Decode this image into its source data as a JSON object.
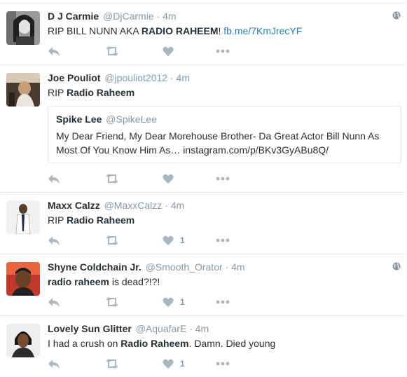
{
  "tweets": [
    {
      "name": "D J Carmie",
      "handle": "@DjCarmie",
      "time": "4m",
      "text_parts": [
        "RIP BILL NUNN AKA ",
        "RADIO RAHEEM",
        "! ",
        "fb.me/7KmJrecYF"
      ],
      "like_count": "",
      "has_globe": true
    },
    {
      "name": "Joe Pouliot",
      "handle": "@jpouliot2012",
      "time": "4m",
      "text_parts": [
        "RIP ",
        "Radio Raheem"
      ],
      "like_count": "",
      "quote": {
        "name": "Spike Lee",
        "handle": "@SpikeLee",
        "text": "My Dear Friend, My Dear Morehouse Brother- Da Great Actor Bill Nunn As Most Of You Know Him As… instagram.com/p/BKv3GyABu8Q/"
      }
    },
    {
      "name": "Maxx Calzz",
      "handle": "@MaxxCalzz",
      "time": "4m",
      "text_parts": [
        "RIP ",
        "Radio Raheem"
      ],
      "like_count": "1"
    },
    {
      "name": "Shyne Coldchain Jr.",
      "handle": "@Smooth_Orator",
      "time": "4m",
      "text_parts": [
        "radio raheem",
        " is dead?!?!"
      ],
      "like_count": "1",
      "has_globe": true
    },
    {
      "name": "Lovely Sun Glitter",
      "handle": "@AquafarE",
      "time": "4m",
      "text_parts": [
        "I had a crush on ",
        "Radio Raheem",
        ". Damn. Died young"
      ],
      "like_count": "1"
    }
  ],
  "header_separator": "·",
  "icons": {
    "reply": "reply-icon",
    "retweet": "retweet-icon",
    "like": "heart-icon",
    "more": "more-icon",
    "globe": "globe-icon"
  },
  "colors": {
    "text": "#292f33",
    "muted": "#8899a6",
    "icon": "#aab8c2",
    "link": "#2b7bb9",
    "border": "#e1e8ed"
  }
}
